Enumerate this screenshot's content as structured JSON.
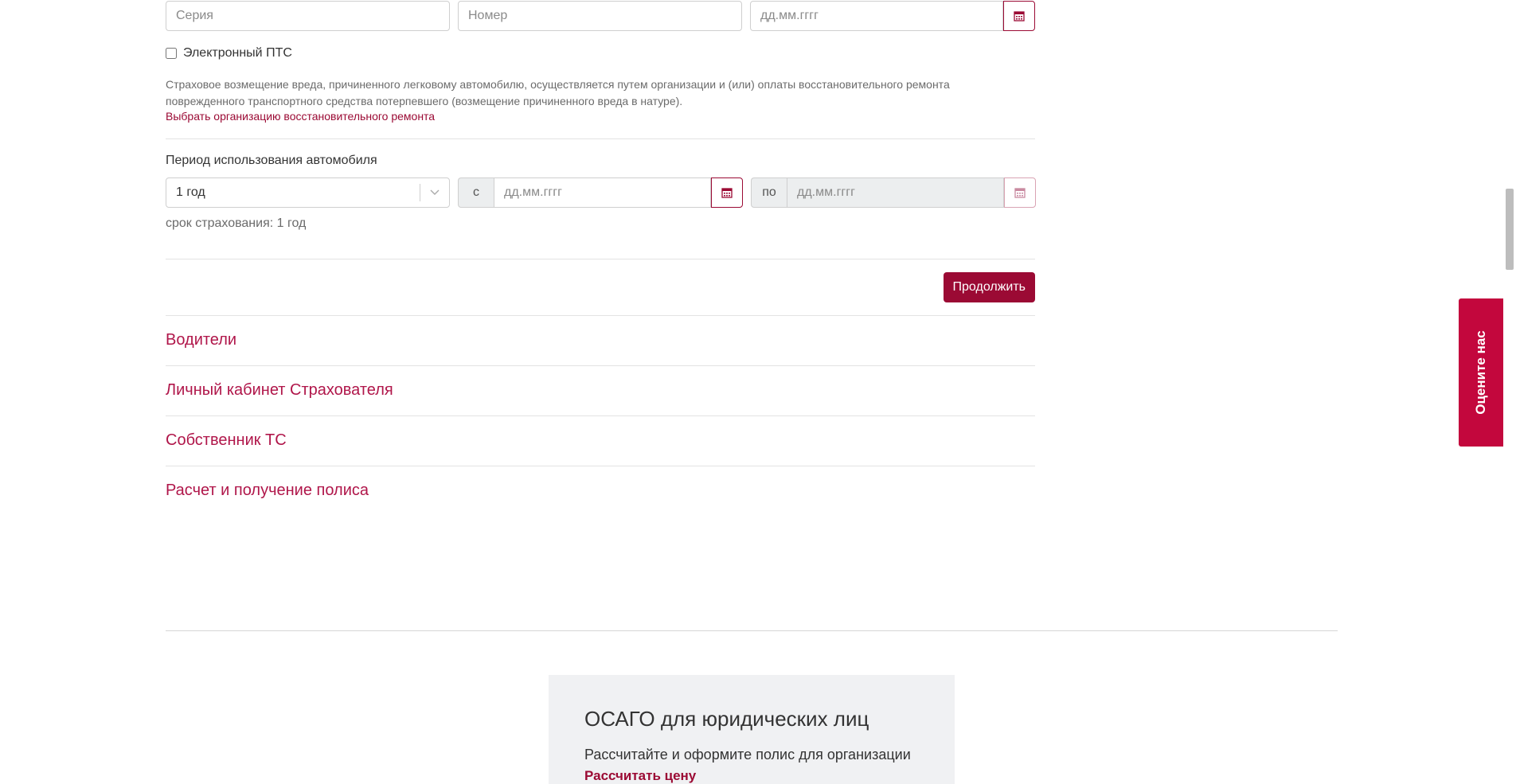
{
  "pts": {
    "series_placeholder": "Серия",
    "number_placeholder": "Номер",
    "date_placeholder": "дд.мм.гггг",
    "electronic_label": "Электронный ПТС"
  },
  "notice": {
    "text": "Страховое возмещение вреда, причиненного легковому автомобилю, осуществляется путем организации и (или) оплаты восстановительного ремонта поврежденного транспортного средства потерпевшего (возмещение причиненного вреда в натуре).",
    "link": "Выбрать организацию восстановительного ремонта"
  },
  "period": {
    "label": "Период использования автомобиля",
    "select_value": "1 год",
    "from_label": "с",
    "from_placeholder": "дд.мм.гггг",
    "to_label": "по",
    "to_placeholder": "дд.мм.гггг",
    "term_text": "срок страхования: 1 год"
  },
  "actions": {
    "continue": "Продолжить"
  },
  "sections": [
    {
      "label": "Водители"
    },
    {
      "label": "Личный кабинет Страхователя"
    },
    {
      "label": "Собственник ТС"
    },
    {
      "label": "Расчет и получение полиса"
    }
  ],
  "promo": {
    "title": "ОСАГО для юридических лиц",
    "text": "Рассчитайте и оформите полис для организации",
    "link": "Рассчитать цену"
  },
  "rate_tab": "Оцените нас",
  "colors": {
    "brand": "#9b0a34",
    "section_link": "#b0164a"
  }
}
